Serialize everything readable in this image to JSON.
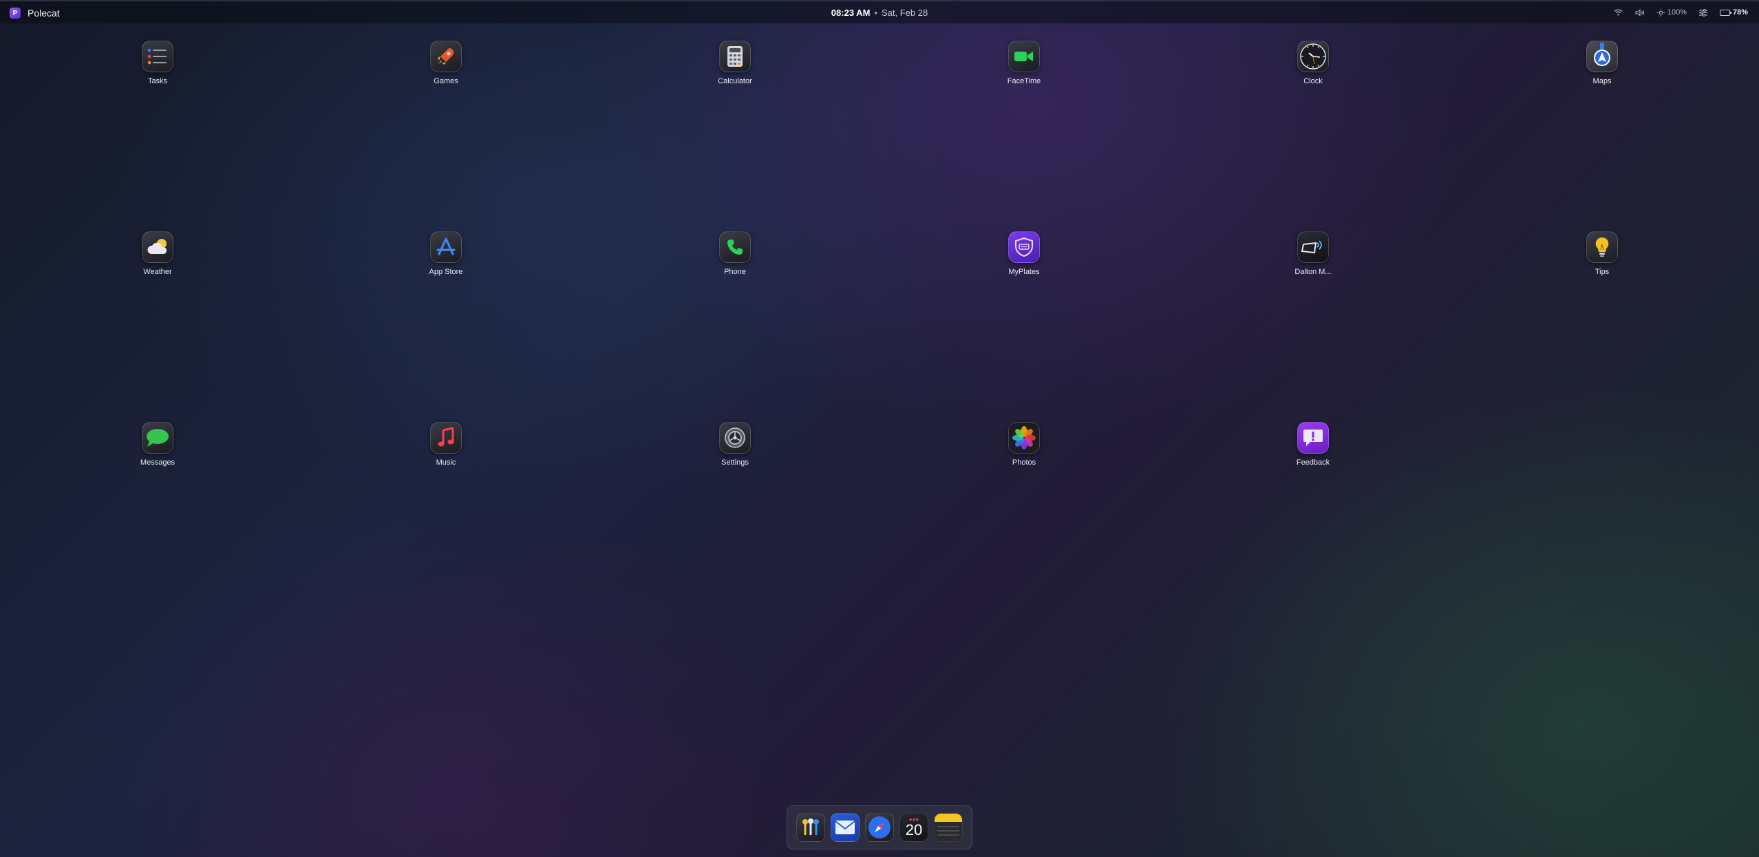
{
  "menubar": {
    "app_name": "Polecat",
    "logo_letter": "P",
    "time": "08:23 AM",
    "separator": "•",
    "date": "Sat, Feb 28",
    "volume_pct": "",
    "brightness": "100%",
    "battery": "78%"
  },
  "apps": [
    {
      "label": "Tasks"
    },
    {
      "label": "Games"
    },
    {
      "label": "Calculator"
    },
    {
      "label": "FaceTime"
    },
    {
      "label": "Clock"
    },
    {
      "label": "Maps"
    },
    {
      "label": "Weather"
    },
    {
      "label": "App Store"
    },
    {
      "label": "Phone"
    },
    {
      "label": "MyPlates"
    },
    {
      "label": "Dalton M..."
    },
    {
      "label": "Tips"
    },
    {
      "label": "Messages"
    },
    {
      "label": "Music"
    },
    {
      "label": "Settings"
    },
    {
      "label": "Photos"
    },
    {
      "label": "Feedback"
    }
  ],
  "dock": {
    "items": [
      "keychain-icon",
      "mail-icon",
      "safari-icon",
      "calendar-icon",
      "notes-icon"
    ],
    "calendar_day": "20"
  },
  "colors": {
    "accent": "#7a4ae6",
    "battery_text": "#e8e8ee"
  }
}
